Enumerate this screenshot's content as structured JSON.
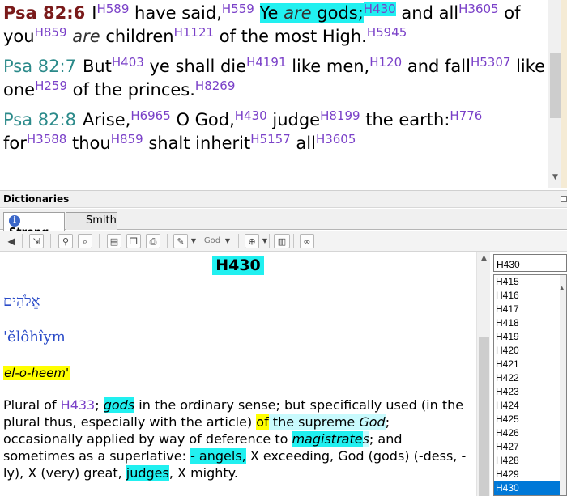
{
  "bible": {
    "verses": [
      {
        "ref": "Psa 82:6",
        "parts": [
          {
            "t": "I"
          },
          {
            "sn": "H589"
          },
          {
            "t": " have said,"
          },
          {
            "sn": "H559"
          },
          {
            "t": " "
          },
          {
            "t": "Ye ",
            "hl": "cyan"
          },
          {
            "t": "are",
            "it": true,
            "hl": "cyan"
          },
          {
            "t": " gods;",
            "hl": "cyan"
          },
          {
            "sn": "H430",
            "hl": "cyan"
          },
          {
            "t": " and all"
          },
          {
            "sn": "H3605"
          },
          {
            "t": " of you"
          },
          {
            "sn": "H859"
          },
          {
            "t": " "
          },
          {
            "t": "are",
            "it": true
          },
          {
            "t": " children"
          },
          {
            "sn": "H1121"
          },
          {
            "t": " of the most High."
          },
          {
            "sn": "H5945"
          }
        ]
      },
      {
        "ref": "Psa 82:7",
        "parts": [
          {
            "t": "But"
          },
          {
            "sn": "H403"
          },
          {
            "t": " ye shall die"
          },
          {
            "sn": "H4191"
          },
          {
            "t": " like men,"
          },
          {
            "sn": "H120"
          },
          {
            "t": " and fall"
          },
          {
            "sn": "H5307"
          },
          {
            "t": " like one"
          },
          {
            "sn": "H259"
          },
          {
            "t": " of the princes."
          },
          {
            "sn": "H8269"
          }
        ]
      },
      {
        "ref": "Psa 82:8",
        "parts": [
          {
            "t": "Arise,"
          },
          {
            "sn": "H6965"
          },
          {
            "t": " O God,"
          },
          {
            "sn": "H430"
          },
          {
            "t": " judge"
          },
          {
            "sn": "H8199"
          },
          {
            "t": " the earth:"
          },
          {
            "sn": "H776"
          },
          {
            "t": " for"
          },
          {
            "sn": "H3588"
          },
          {
            "t": " thou"
          },
          {
            "sn": "H859"
          },
          {
            "t": " shalt inherit"
          },
          {
            "sn": "H5157"
          },
          {
            "t": " all"
          },
          {
            "sn": "H3605"
          }
        ]
      }
    ]
  },
  "dictionaries": {
    "header_title": "Dictionaries",
    "tabs": [
      {
        "label": "Strong",
        "active": true
      },
      {
        "label": "Smith",
        "active": false
      }
    ],
    "toolbar_god_label": "God"
  },
  "definition": {
    "title": "H430",
    "hebrew": "אֱלֹהִים",
    "transliteration": "'ĕlôhîym",
    "pronunciation": "el-o-heem'",
    "body_parts": [
      {
        "t": "Plural of "
      },
      {
        "t": "H433",
        "cls": "h433"
      },
      {
        "t": "; "
      },
      {
        "t": "gods",
        "cls": "cyanit"
      },
      {
        "t": " in the ordinary sense; but specifically used (in the plural thus, especially with the article) "
      },
      {
        "t": "of",
        "cls": "yellow"
      },
      {
        "t": " the supreme ",
        "cls": "ltcyan"
      },
      {
        "t": "God",
        "cls": "ltcyan it"
      },
      {
        "t": "; occasionally applied by way of deference to "
      },
      {
        "t": "magistrate",
        "cls": "cyanit"
      },
      {
        "t": "s",
        "cls": "ltcyan it"
      },
      {
        "t": "; and sometimes as a superlative: "
      },
      {
        "t": "- angels,",
        "cls": "cyan"
      },
      {
        "t": " X exceeding, God (gods) (-dess, -ly), X (very) great, "
      },
      {
        "t": "judges",
        "cls": "cyan"
      },
      {
        "t": ", X mighty."
      }
    ]
  },
  "strong_list": {
    "search_value": "H430",
    "items": [
      "H415",
      "H416",
      "H417",
      "H418",
      "H419",
      "H420",
      "H421",
      "H422",
      "H423",
      "H424",
      "H425",
      "H426",
      "H427",
      "H428",
      "H429",
      "H430"
    ],
    "selected": "H430"
  },
  "icons": {
    "info": "i",
    "scroll_up": "▲",
    "scroll_down": "▼"
  }
}
